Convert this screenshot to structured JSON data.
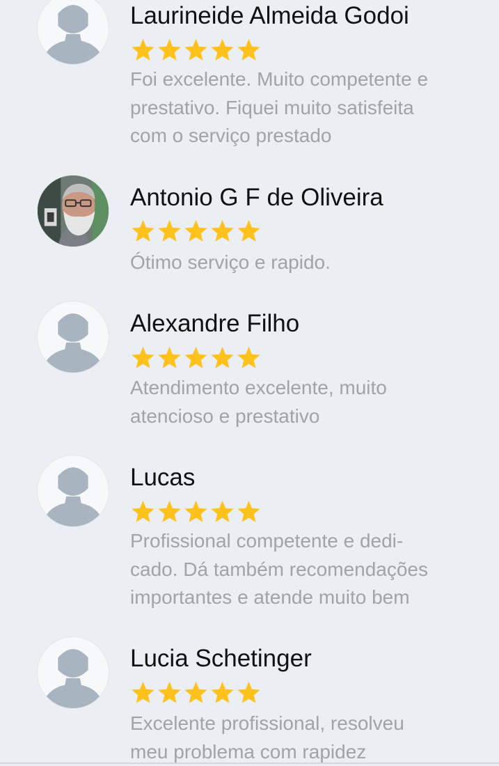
{
  "reviews": [
    {
      "name": "Laurineide Almeida Godoi",
      "rating": 5,
      "avatar": "default-user-icon",
      "comment": "Foi excelente. Muito competente e\nprestativo. Fiquei muito satisfeita\ncom o serviço prestado"
    },
    {
      "name": "Antonio G F de Oliveira",
      "rating": 5,
      "avatar": "user-photo",
      "comment": "Ótimo serviço e rapido."
    },
    {
      "name": "Alexandre Filho",
      "rating": 5,
      "avatar": "default-user-icon",
      "comment": "Atendimento excelente, muito\natencioso e prestativo"
    },
    {
      "name": "Lucas",
      "rating": 5,
      "avatar": "default-user-icon",
      "comment": "Profissional competente e dedi-\ncado. Dá também recomendações\nimportantes e atende muito bem"
    },
    {
      "name": "Lucia Schetinger",
      "rating": 5,
      "avatar": "default-user-icon",
      "comment": "Excelente profissional, resolveu\nmeu problema com rapidez"
    }
  ],
  "colors": {
    "background": "#ebeef2",
    "star": "#ffc21c",
    "name": "#111111",
    "comment": "#a0a3a7",
    "avatar_silhouette": "#a8b4bf"
  }
}
